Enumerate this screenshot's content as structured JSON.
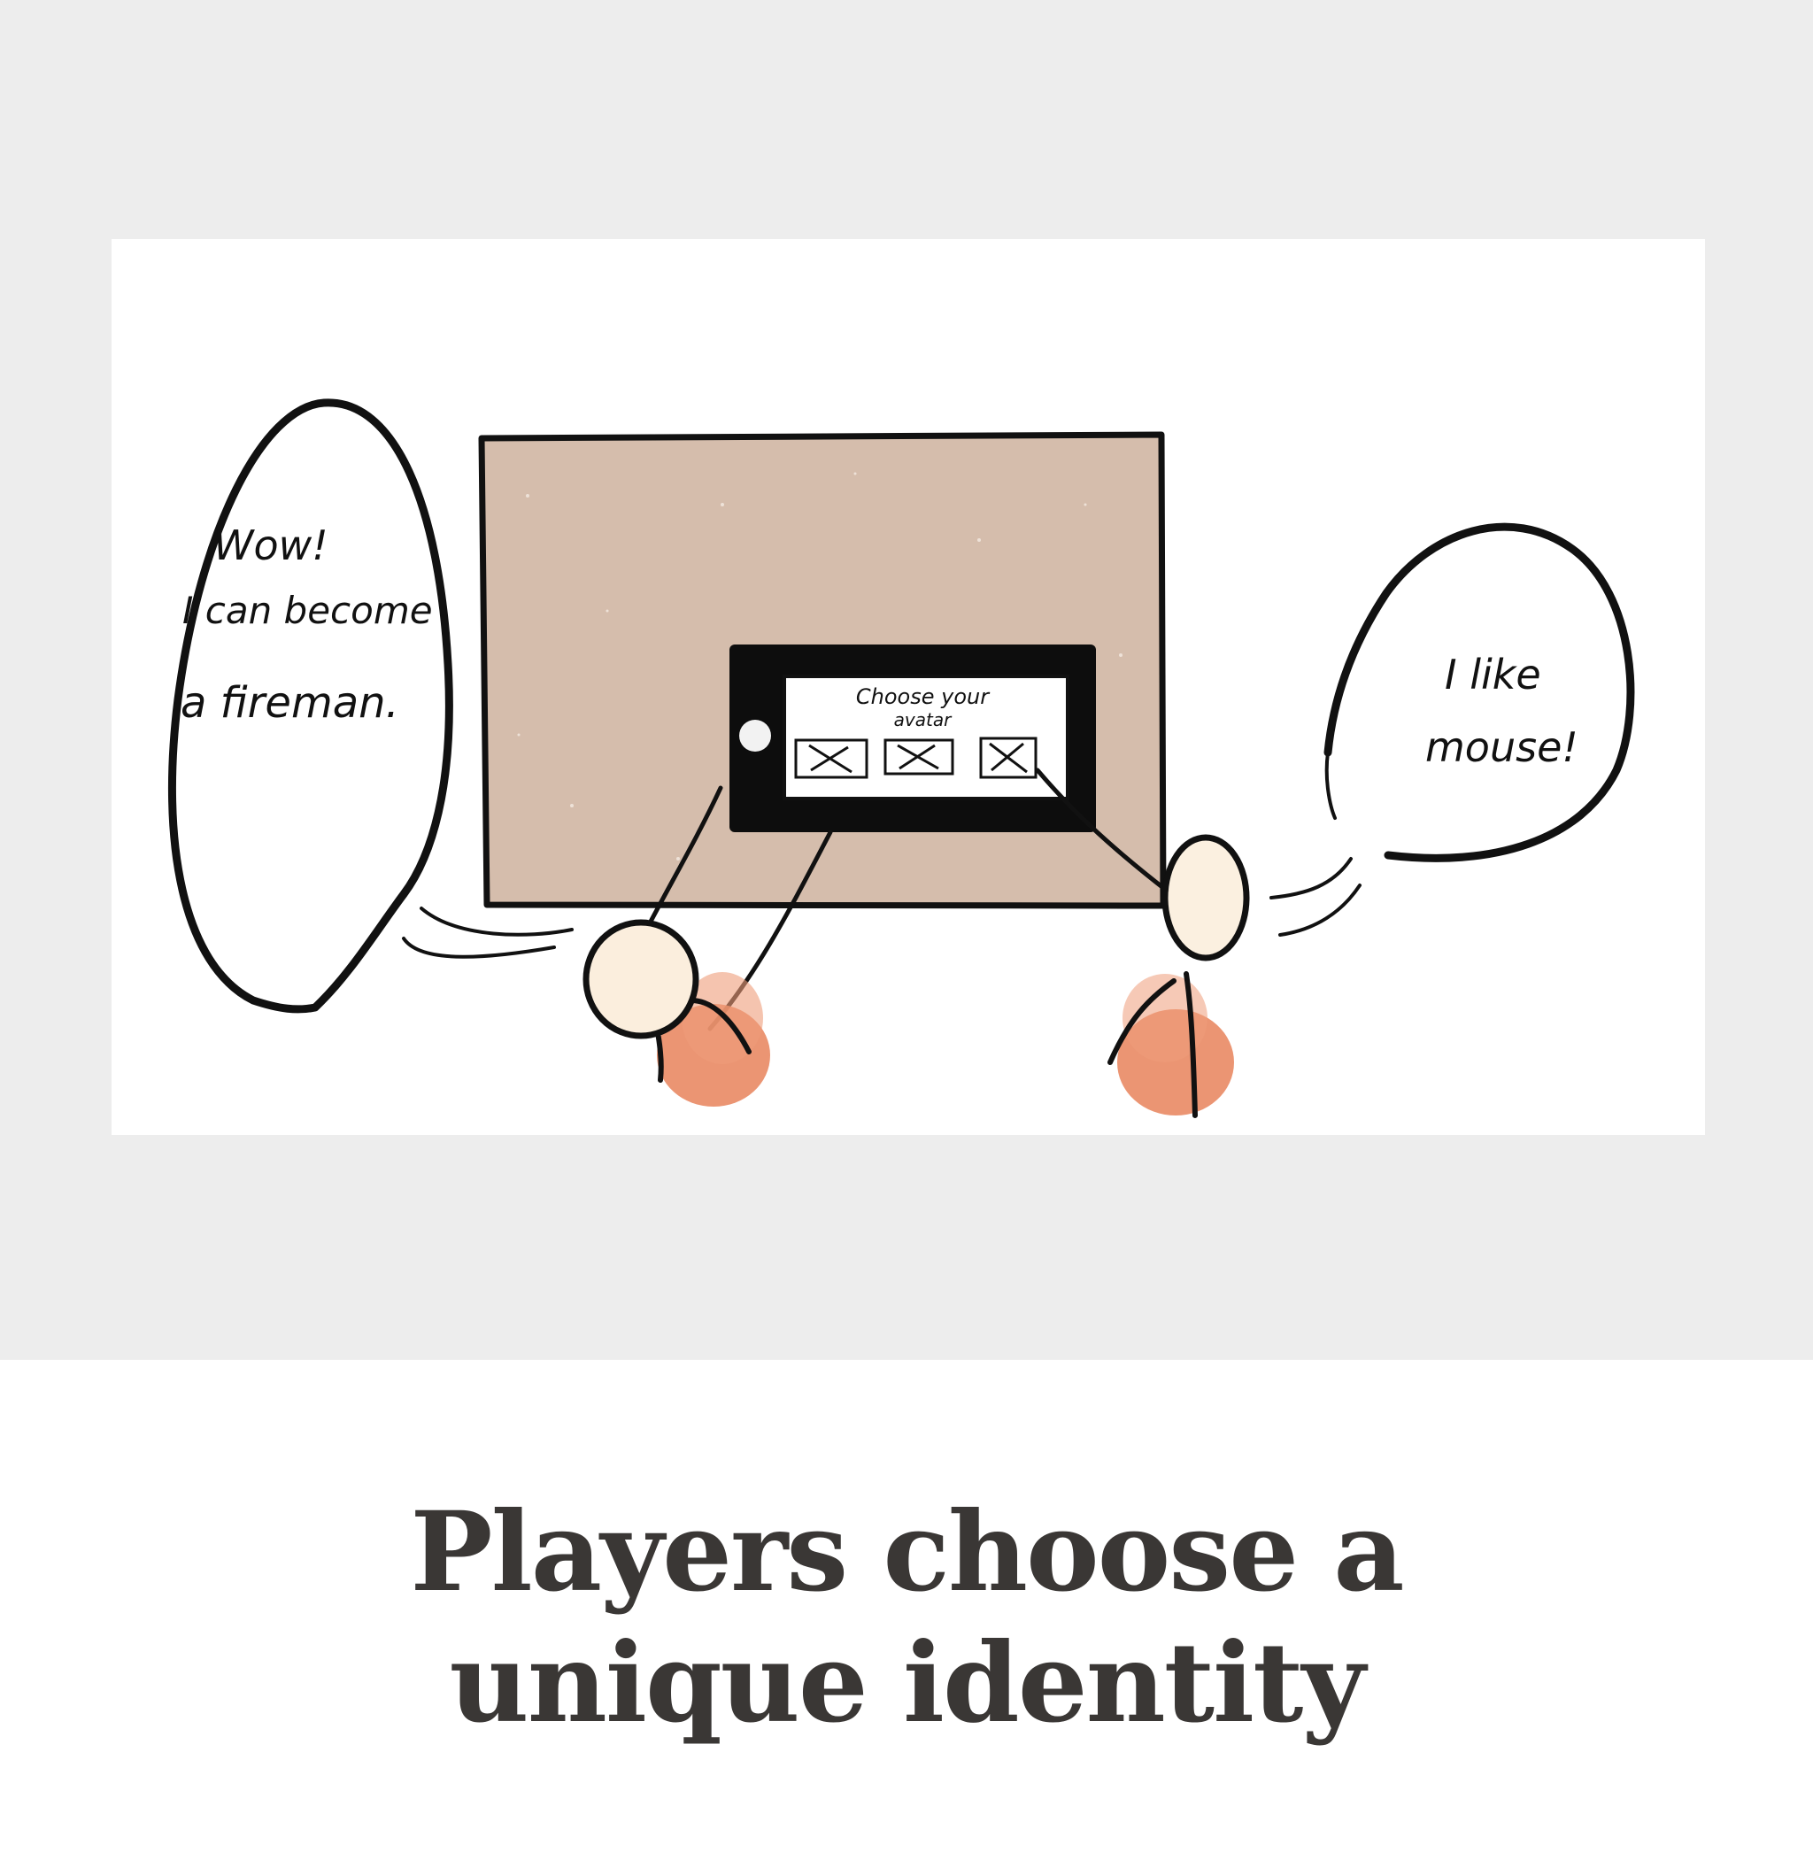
{
  "illustration": {
    "left_bubble": {
      "lines": [
        "Wow!",
        "I can become",
        "a fireman."
      ]
    },
    "right_bubble": {
      "lines": [
        "I like",
        "mouse!"
      ]
    },
    "tablet_screen": {
      "lines": [
        "Choose your",
        "avatar"
      ]
    },
    "colors": {
      "table": "#d5bdac",
      "player_body": "#e8835a",
      "player_head": "#fbeedd",
      "ink": "#111111",
      "background_band": "#ededed"
    }
  },
  "caption": {
    "line1": "Players choose a",
    "line2": "unique identity"
  }
}
